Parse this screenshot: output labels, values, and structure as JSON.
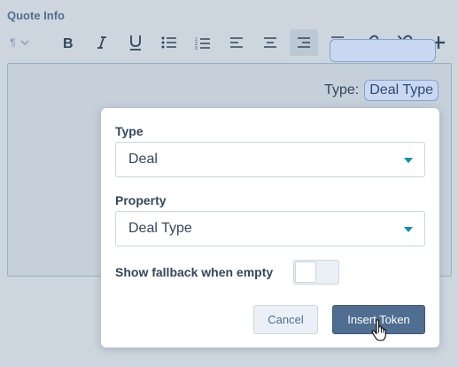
{
  "section": {
    "title": "Quote Info"
  },
  "toolbar": {
    "buttons": [
      {
        "name": "paragraph-format-icon"
      },
      {
        "name": "bold-icon"
      },
      {
        "name": "italic-icon"
      },
      {
        "name": "underline-icon"
      },
      {
        "name": "bulleted-list-icon"
      },
      {
        "name": "numbered-list-icon"
      },
      {
        "name": "align-left-icon"
      },
      {
        "name": "align-center-icon"
      },
      {
        "name": "align-right-icon",
        "active": true
      },
      {
        "name": "justify-icon"
      },
      {
        "name": "link-icon"
      },
      {
        "name": "unlink-icon"
      },
      {
        "name": "plus-icon"
      }
    ],
    "paragraph_glyph": "¶"
  },
  "editor": {
    "label": "Type:",
    "token": "Deal Type"
  },
  "popover": {
    "type_label": "Type",
    "type_value": "Deal",
    "property_label": "Property",
    "property_value": "Deal Type",
    "fallback_label": "Show fallback when empty",
    "fallback_enabled": false,
    "cancel_label": "Cancel",
    "insert_label": "Insert Token"
  },
  "colors": {
    "accent": "#0091ae",
    "primary_button": "#506e91",
    "token_chip": "#c9d8f0"
  }
}
